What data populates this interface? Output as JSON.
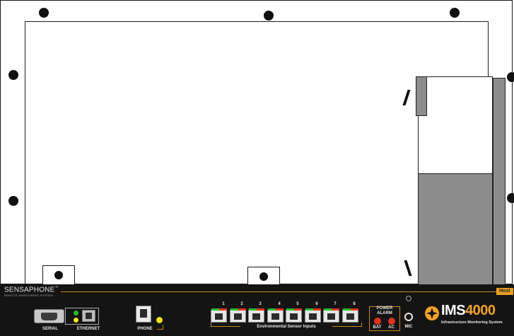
{
  "panel": {
    "brand": "SENSAPHONE",
    "brand_tm": "™",
    "brand_sub": "REMOTE MONITORING SYSTEM",
    "host_badge": "Host",
    "serial_label": "SERIAL",
    "ethernet_label": "ETHERNET",
    "phone_label": "PHONE",
    "sensor_numbers": [
      "1",
      "2",
      "3",
      "4",
      "5",
      "6",
      "7",
      "8"
    ],
    "sensor_label": "Environmental Sensor Inputs",
    "power_alarm_line1": "POWER",
    "power_alarm_line2": "ALARM",
    "bat_label": "BAT",
    "ac_label": "AC",
    "mic_label": "MIC",
    "product_prefix": "IMS",
    "product_number": "4000",
    "product_sub": "Infrastructure Monitoring System"
  },
  "colors": {
    "panel_bg": "#141414",
    "accent_orange": "#f2a22b",
    "led_green": "#21c02b",
    "led_yellow": "#f5e21a",
    "led_red": "#e0341e",
    "module_gray": "#8c8c8c"
  }
}
